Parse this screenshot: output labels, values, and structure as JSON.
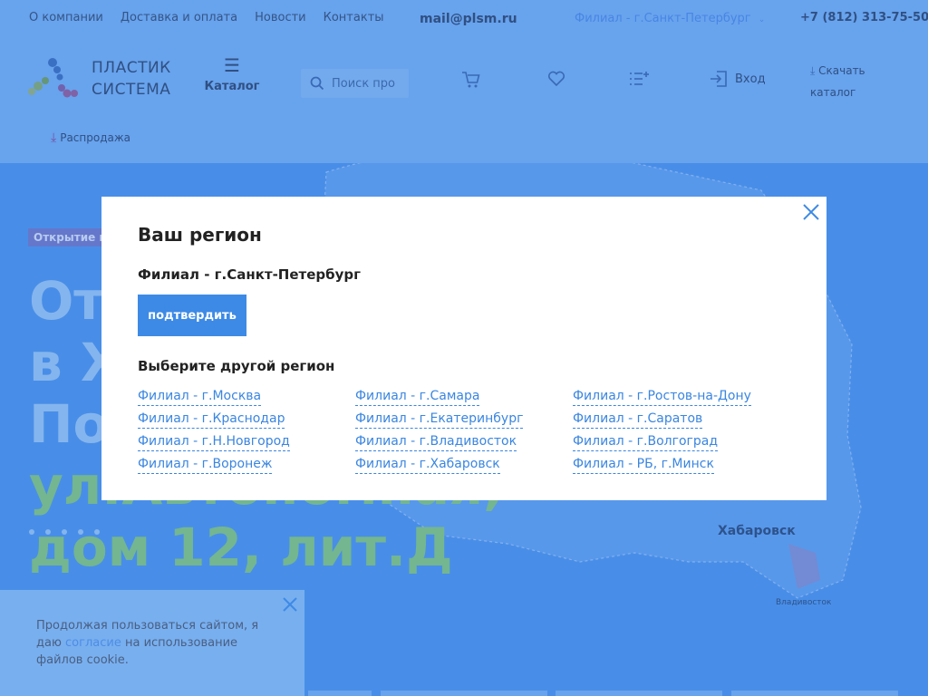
{
  "topbar": {
    "nav": [
      "О компании",
      "Доставка и оплата",
      "Новости",
      "Контакты"
    ],
    "email": "mail@plsm.ru",
    "branch": "Филиал - г.Санкт-Петербург",
    "phone": "+7 (812) 313-75-50"
  },
  "header": {
    "brand_line1": "ПЛАСТИК",
    "brand_line2": "СИСТЕМА",
    "catalog_label": "Каталог",
    "search_placeholder": "Поиск про",
    "login_label": "Вход",
    "download_line1": "Скачать",
    "download_line2": "каталог",
    "sale_label": "Распродажа"
  },
  "hero": {
    "badge": "Открытие но",
    "title_line1": "От",
    "title_line2": "в Х",
    "title_line3": "По",
    "title_line4": "ул.Автономная,",
    "title_line5": "дом 12, лит.Д",
    "map_city": "Хабаровск",
    "map_city_small": "Владивосток"
  },
  "modal": {
    "title": "Ваш регион",
    "current_region": "Филиал - г.Санкт-Петербург",
    "confirm_label": "подтвердить",
    "other_title": "Выберите другой регион",
    "regions": [
      "Филиал - г.Москва",
      "Филиал - г.Самара",
      "Филиал - г.Ростов-на-Дону",
      "Филиал - г.Краснодар",
      "Филиал - г.Екатеринбург",
      "Филиал - г.Саратов",
      "Филиал - г.Н.Новгород",
      "Филиал - г.Владивосток",
      "Филиал - г.Волгоград",
      "Филиал - г.Воронеж",
      "Филиал - г.Хабаровск",
      "Филиал - РБ, г.Минск"
    ]
  },
  "cookie": {
    "text_before": "Продолжая пользоваться сайтом, я даю ",
    "link": "согласие",
    "text_after": " на использование файлов cookie."
  },
  "colors": {
    "accent": "#3d8ae6",
    "link": "#3a86e0",
    "hero_bg": "#4a91ea",
    "header_bg": "#6fa9ef"
  }
}
